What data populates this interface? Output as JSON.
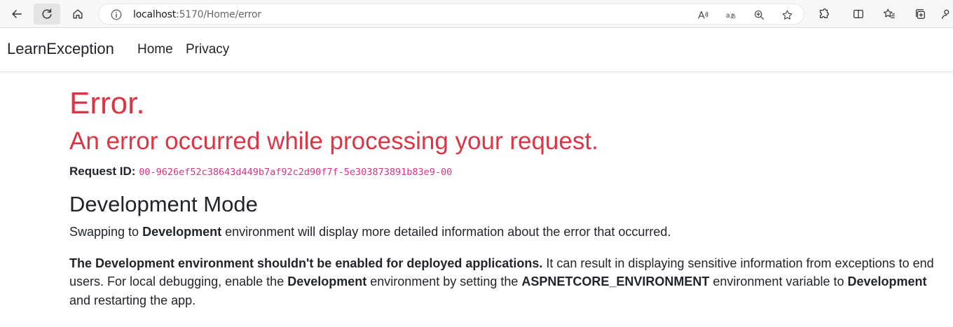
{
  "browser": {
    "url_host": "localhost",
    "url_rest": ":5170/Home/error",
    "buttons": [
      "back-icon",
      "refresh-icon",
      "home-icon",
      "info-icon",
      "read-aloud-icon",
      "translate-icon",
      "zoom-icon",
      "favorite-star-icon",
      "extensions-icon",
      "split-screen-icon",
      "favorites-icon",
      "collections-icon"
    ]
  },
  "navbar": {
    "brand": "LearnException",
    "links": [
      "Home",
      "Privacy"
    ]
  },
  "page": {
    "title": "Error.",
    "subtitle": "An error occurred while processing your request.",
    "request_label": "Request ID:",
    "request_id": "00-9626ef52c38643d449b7af92c2d90f7f-5e303873891b83e9-00",
    "dev_heading": "Development Mode",
    "p1": {
      "a": "Swapping to ",
      "b": "Development",
      "c": " environment will display more detailed information about the error that occurred."
    },
    "p2": {
      "a": "The Development environment shouldn't be enabled for deployed applications.",
      "b": " It can result in displaying sensitive information from exceptions to end users. For local debugging, enable the ",
      "c": "Development",
      "d": " environment by setting the ",
      "e": "ASPNETCORE_ENVIRONMENT",
      "f": " environment variable to ",
      "g": "Development",
      "h": " and restarting the app."
    }
  },
  "colors": {
    "error_red": "#dc3545",
    "code_pink": "#d63384",
    "text": "#212529"
  }
}
